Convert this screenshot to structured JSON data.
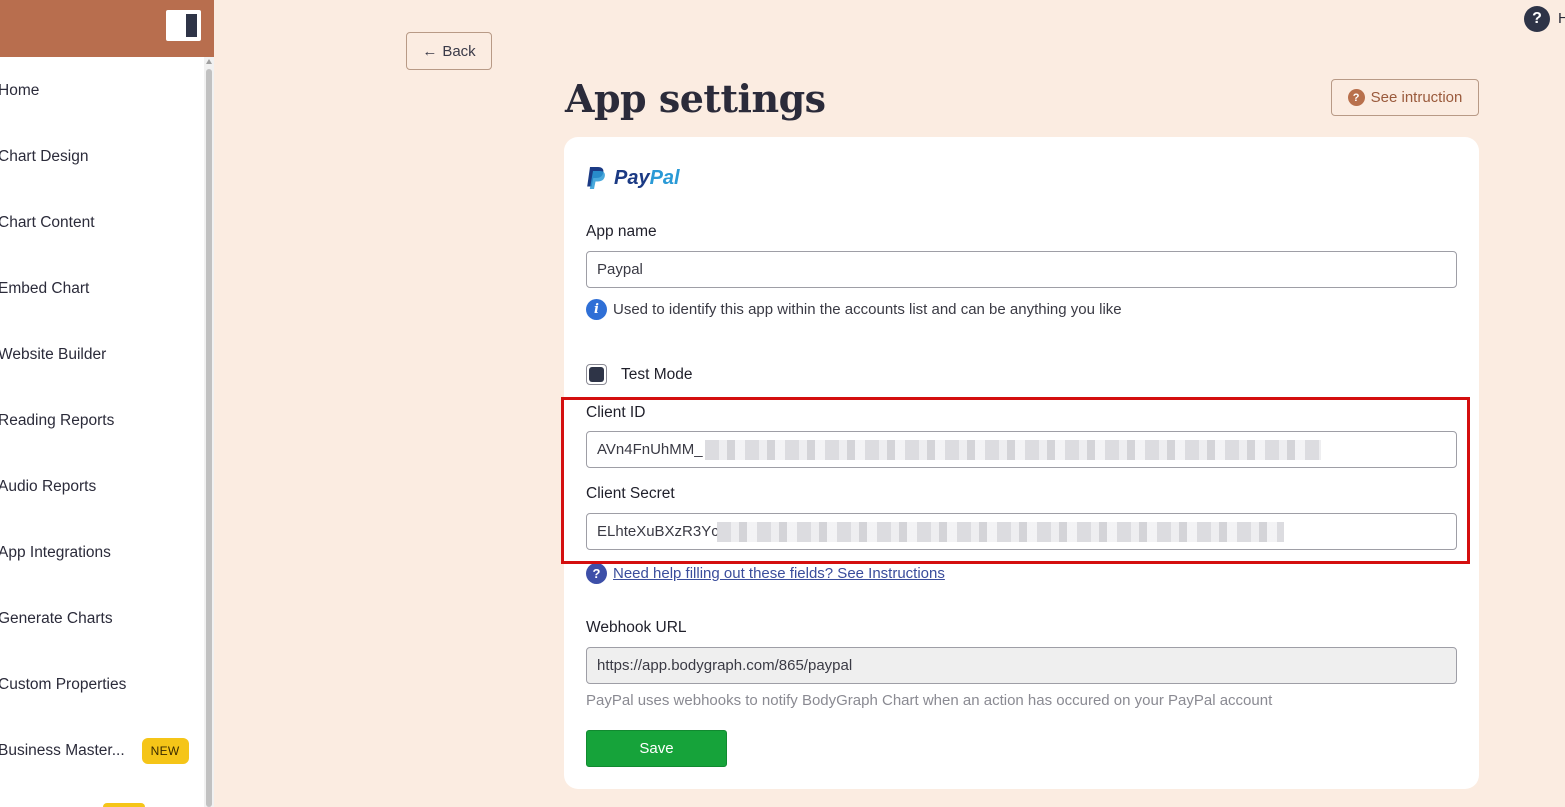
{
  "sidebar": {
    "items": [
      {
        "label": "Home"
      },
      {
        "label": "Chart Design"
      },
      {
        "label": "Chart Content"
      },
      {
        "label": "Embed Chart"
      },
      {
        "label": "Website Builder"
      },
      {
        "label": "Reading Reports"
      },
      {
        "label": "Audio Reports"
      },
      {
        "label": "App Integrations"
      },
      {
        "label": "Generate Charts"
      },
      {
        "label": "Custom Properties"
      },
      {
        "label": "Business Master...",
        "badge": "NEW"
      }
    ]
  },
  "header": {
    "help_icon": "?",
    "help_text": "H",
    "back_label": "Back",
    "back_arrow": "←",
    "title": "App settings",
    "instructions_label": "See intruction",
    "instructions_icon": "?"
  },
  "card": {
    "logo_pay": "Pay",
    "logo_pal": "Pal",
    "app_name_label": "App name",
    "app_name_value": "Paypal",
    "app_name_help": "Used to identify this app within the accounts list and can be anything you like",
    "info_icon": "i",
    "test_mode_label": "Test Mode",
    "test_mode_checked": true,
    "client_id_label": "Client ID",
    "client_id_value": "AVn4FnUhMM_",
    "client_secret_label": "Client Secret",
    "client_secret_value": "ELhteXuBXzR3Yc",
    "help_link_text": "Need help filling out these fields? See Instructions",
    "help_icon": "?",
    "webhook_label": "Webhook URL",
    "webhook_value": "https://app.bodygraph.com/865/paypal",
    "webhook_note": "PayPal uses webhooks to notify BodyGraph Chart when an action has occured on your PayPal account",
    "save_label": "Save"
  },
  "colors": {
    "sidebar_header": "#b86e4e",
    "background": "#fbece1",
    "accent_dark": "#2e3447",
    "save_green": "#16a33a",
    "highlight_red": "#d40f0f",
    "badge_yellow": "#f5c518"
  }
}
